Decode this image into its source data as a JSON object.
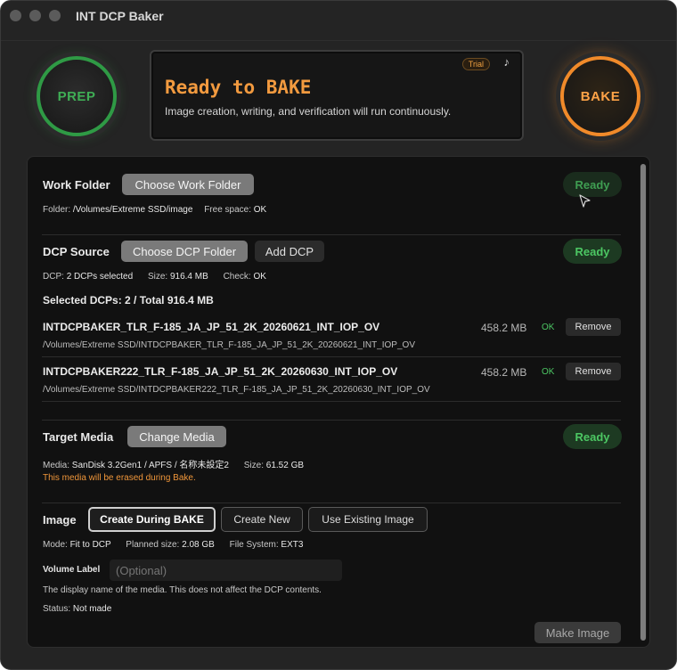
{
  "window": {
    "title": "INT DCP Baker"
  },
  "buttons": {
    "prep": "PREP",
    "bake": "BAKE"
  },
  "status": {
    "title": "Ready to BAKE",
    "subtitle": "Image creation, writing, and verification will run continuously.",
    "badge": "Trial",
    "music_icon": "music-note-icon"
  },
  "work_folder": {
    "title": "Work Folder",
    "choose_label": "Choose Work Folder",
    "status": "Ready",
    "folder_label": "Folder:",
    "folder_value": "/Volumes/Extreme SSD/image",
    "free_label": "Free space:",
    "free_value": "OK"
  },
  "dcp_source": {
    "title": "DCP Source",
    "choose_label": "Choose DCP Folder",
    "add_label": "Add DCP",
    "status": "Ready",
    "dcp_label": "DCP:",
    "dcp_value": "2 DCPs selected",
    "size_label": "Size:",
    "size_value": "916.4 MB",
    "check_label": "Check:",
    "check_value": "OK",
    "selected_summary": "Selected DCPs: 2 / Total 916.4 MB",
    "items": [
      {
        "name": "INTDCPBAKER_TLR_F-185_JA_JP_51_2K_20260621_INT_IOP_OV",
        "path": "/Volumes/Extreme SSD/INTDCPBAKER_TLR_F-185_JA_JP_51_2K_20260621_INT_IOP_OV",
        "size": "458.2 MB",
        "check": "OK",
        "remove_label": "Remove"
      },
      {
        "name": "INTDCPBAKER222_TLR_F-185_JA_JP_51_2K_20260630_INT_IOP_OV",
        "path": "/Volumes/Extreme SSD/INTDCPBAKER222_TLR_F-185_JA_JP_51_2K_20260630_INT_IOP_OV",
        "size": "458.2 MB",
        "check": "OK",
        "remove_label": "Remove"
      }
    ]
  },
  "target_media": {
    "title": "Target Media",
    "change_label": "Change Media",
    "status": "Ready",
    "media_label": "Media:",
    "media_value": "SanDisk 3.2Gen1 / APFS / 名称未設定2",
    "size_label": "Size:",
    "size_value": "61.52 GB",
    "warning": "This media will be erased during Bake."
  },
  "image": {
    "title": "Image",
    "tabs": [
      "Create During BAKE",
      "Create New",
      "Use Existing Image"
    ],
    "mode_label": "Mode:",
    "mode_value": "Fit to DCP",
    "planned_label": "Planned size:",
    "planned_value": "2.08 GB",
    "fs_label": "File System:",
    "fs_value": "EXT3",
    "volume_label": "Volume Label",
    "volume_placeholder": "(Optional)",
    "volume_help": "The display name of the media. This does not affect the DCP contents.",
    "status_label": "Status:",
    "status_value": "Not made",
    "make_label": "Make Image"
  },
  "colors": {
    "accent_orange": "#f29a3f",
    "ready_green": "#4cc763",
    "prep_green": "#2f9a45",
    "bake_orange": "#f08a2a",
    "warning_orange": "#f0963a"
  }
}
